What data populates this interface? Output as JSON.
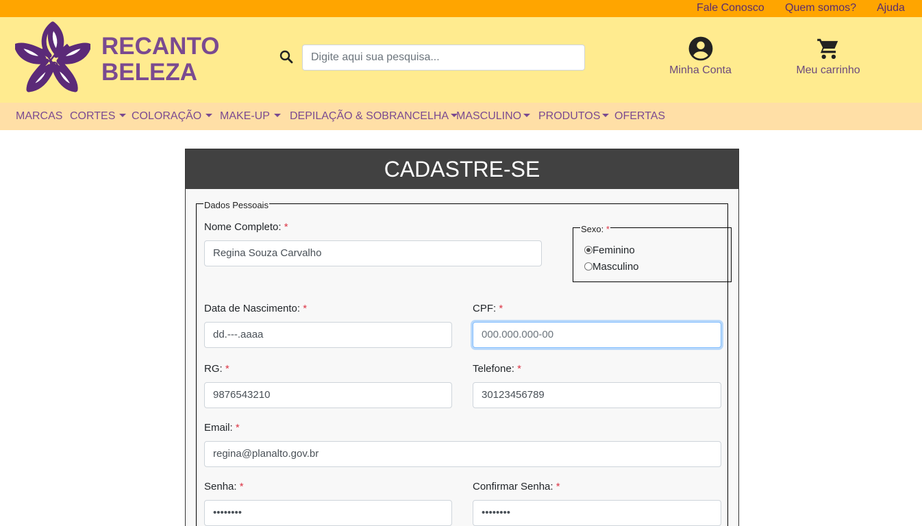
{
  "topbar": {
    "links": [
      "Fale Conosco",
      "Quem somos?",
      "Ajuda"
    ]
  },
  "header": {
    "brand_line1": "RECANTO",
    "brand_line2": "BELEZA",
    "search_placeholder": "Digite aqui sua pesquisa...",
    "account_label": "Minha Conta",
    "cart_label": "Meu carrinho"
  },
  "nav": {
    "items": [
      "MARCAS",
      "CORTES",
      "COLORAÇÃO",
      "MAKE-UP",
      "DEPILAÇÃO & SOBRANCELHA",
      "MASCULINO",
      "PRODUTOS",
      "OFERTAS"
    ]
  },
  "form": {
    "title": "CADASTRE-SE",
    "legend": "Dados Pessoais",
    "required_mark": "*",
    "nome_label": "Nome Completo:",
    "nome_value": "Regina Souza Carvalho",
    "sexo_label": "Sexo:",
    "sexo_options": [
      "Feminino",
      "Masculino"
    ],
    "nascimento_label": "Data de Nascimento:",
    "nascimento_value": "dd.---.aaaa",
    "cpf_label": "CPF:",
    "cpf_placeholder": "000.000.000-00",
    "rg_label": "RG:",
    "rg_value": "9876543210",
    "telefone_label": "Telefone:",
    "telefone_value": "30123456789",
    "email_label": "Email:",
    "email_value": "regina@planalto.gov.br",
    "senha_label": "Senha:",
    "senha_value": "••••••••",
    "confirmar_label": "Confirmar Senha:",
    "confirmar_value": "••••••••"
  },
  "colors": {
    "topbar": "#ffa500",
    "header": "#ffeb8f",
    "nav": "#ffdfa6",
    "brand": "#7a4a90",
    "card_header": "#414141"
  }
}
